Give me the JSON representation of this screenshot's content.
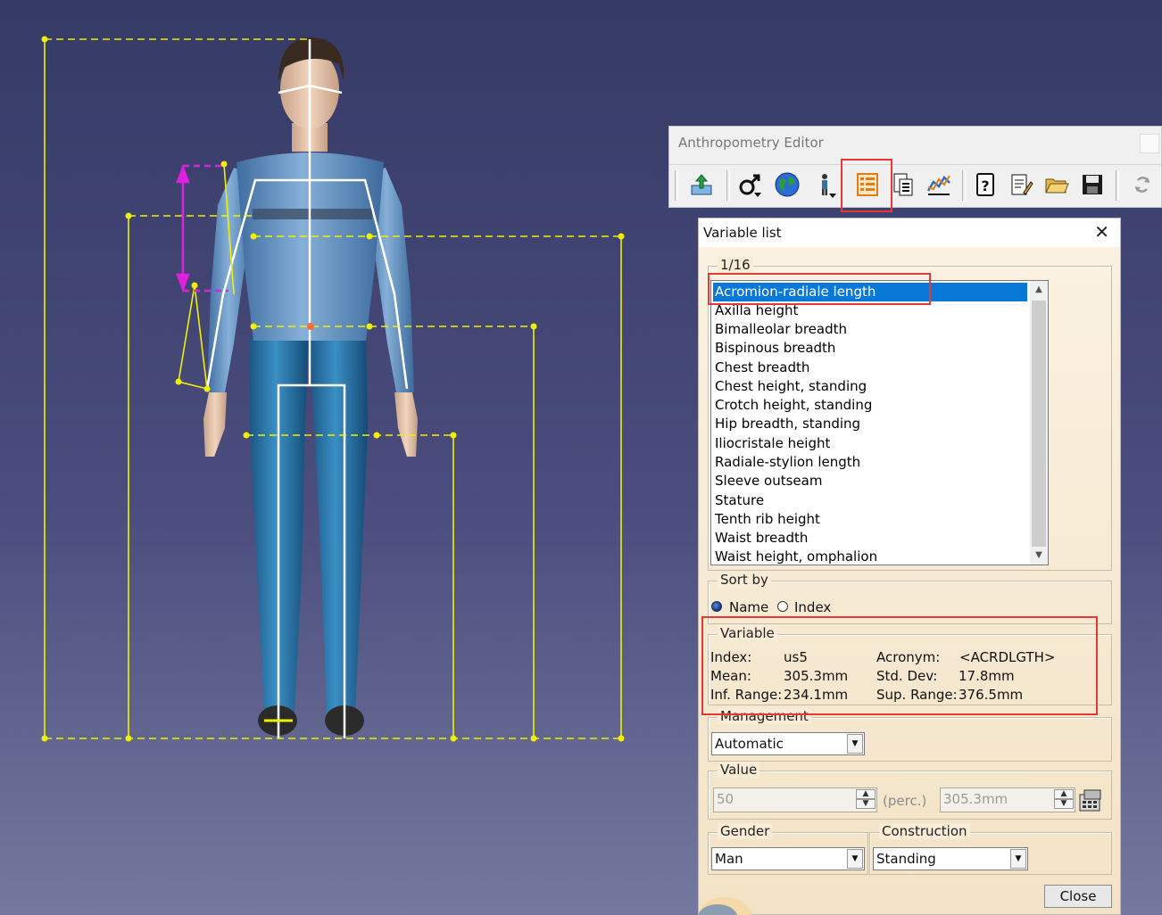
{
  "anthropometry_editor": {
    "title": "Anthropometry Editor",
    "toolbar_icons": [
      "export-icon",
      "gender-icon",
      "population-icon",
      "manikin-posture-icon",
      "variable-list-icon",
      "filter-list-icon",
      "chart-icon",
      "help-icon",
      "edit-icon",
      "open-folder-icon",
      "save-icon",
      "refresh-icon"
    ]
  },
  "variable_list": {
    "title": "Variable list",
    "page_indicator": "1/16",
    "items": [
      "Acromion-radiale length",
      "Axilla height",
      "Bimalleolar breadth",
      "Bispinous breadth",
      "Chest breadth",
      "Chest height, standing",
      "Crotch height, standing",
      "Hip breadth, standing",
      "Iliocristale height",
      "Radiale-stylion length",
      "Sleeve outseam",
      "Stature",
      "Tenth rib height",
      "Waist breadth",
      "Waist height, omphalion"
    ],
    "selected_index": 0,
    "sort_by": {
      "label": "Sort by",
      "name_label": "Name",
      "index_label": "Index",
      "selected": "Name"
    },
    "variable": {
      "label": "Variable",
      "index_label": "Index:",
      "index_value": "us5",
      "acronym_label": "Acronym:",
      "acronym_value": "<ACRDLGTH>",
      "mean_label": "Mean:",
      "mean_value": "305.3mm",
      "std_label": "Std. Dev:",
      "std_value": "17.8mm",
      "inf_label": "Inf. Range:",
      "inf_value": "234.1mm",
      "sup_label": "Sup. Range:",
      "sup_value": "376.5mm"
    },
    "management": {
      "label": "Management",
      "value": "Automatic"
    },
    "value": {
      "label": "Value",
      "percentile": "50",
      "perc_label": "(perc.)",
      "measure": "305.3mm"
    },
    "gender": {
      "label": "Gender",
      "value": "Man"
    },
    "construction": {
      "label": "Construction",
      "value": "Standing"
    },
    "close_label": "Close"
  },
  "colors": {
    "guide_yellow": "#f0f000",
    "selected_magenta": "#e020e0",
    "highlight_red": "#e53935",
    "selection_blue": "#0a78d7"
  }
}
